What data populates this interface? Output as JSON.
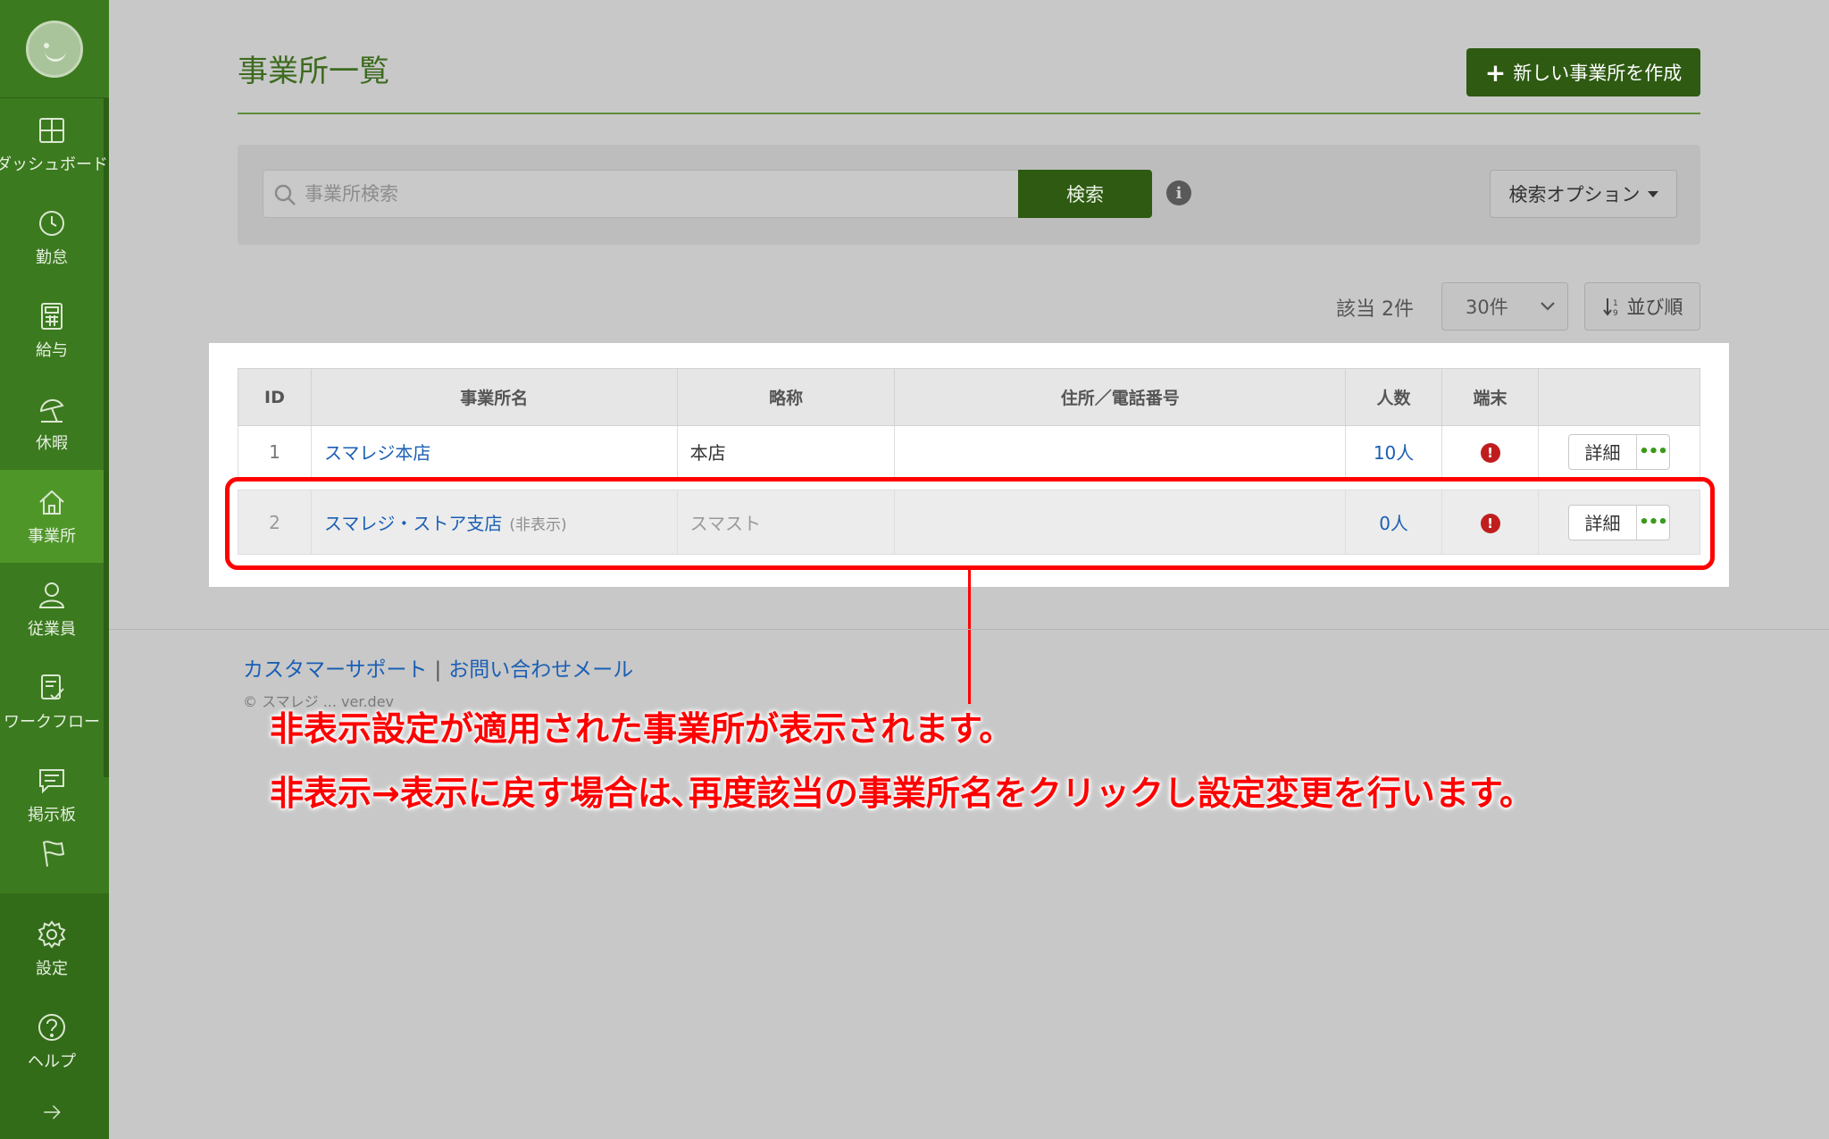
{
  "sidebar": {
    "items": [
      {
        "label": "ダッシュボード",
        "icon": "dashboard-icon"
      },
      {
        "label": "勤怠",
        "icon": "clock-icon"
      },
      {
        "label": "給与",
        "icon": "calculator-icon"
      },
      {
        "label": "休暇",
        "icon": "beach-umbrella-icon"
      },
      {
        "label": "事業所",
        "icon": "home-icon",
        "active": true
      },
      {
        "label": "従業員",
        "icon": "person-icon"
      },
      {
        "label": "ワークフロー",
        "icon": "checklist-icon"
      },
      {
        "label": "掲示板",
        "icon": "message-board-icon"
      },
      {
        "label": "",
        "icon": "flag-icon"
      },
      {
        "label": "設定",
        "icon": "gear-icon"
      },
      {
        "label": "ヘルプ",
        "icon": "help-icon"
      }
    ],
    "expand_icon": "arrow-right-icon"
  },
  "header": {
    "title": "事業所一覧",
    "new_button_label": "新しい事業所を作成"
  },
  "search": {
    "placeholder": "事業所検索",
    "button_label": "検索",
    "options_label": "検索オプション"
  },
  "results": {
    "count_label": "該当 2件",
    "per_page": "30件",
    "sort_label": "並び順"
  },
  "table": {
    "headers": [
      "ID",
      "事業所名",
      "略称",
      "住所／電話番号",
      "人数",
      "端末",
      ""
    ],
    "rows": [
      {
        "id": "1",
        "name": "スマレジ本店",
        "hidden_tag": "",
        "abbr": "本店",
        "address": "",
        "people": "10人",
        "detail": "詳細",
        "more": "•••"
      },
      {
        "id": "2",
        "name": "スマレジ・ストア支店",
        "hidden_tag": "(非表示)",
        "abbr": "スマスト",
        "address": "",
        "people": "0人",
        "detail": "詳細",
        "more": "•••"
      }
    ]
  },
  "footer": {
    "support_link": "カスタマーサポート",
    "separator": "|",
    "mail_link": "お問い合わせメール",
    "copyright": "© スマレジ ... ver.dev"
  },
  "annotation": {
    "line1": "非表示設定が適用された事業所が表示されます。",
    "line2": "非表示→表示に戻す場合は､再度該当の事業所名をクリックし設定変更を行います。"
  },
  "colors": {
    "sidebar": "#3b7a1e",
    "primary_button": "#2e5a12",
    "link": "#1b5fb4",
    "highlight": "#ff0000"
  }
}
